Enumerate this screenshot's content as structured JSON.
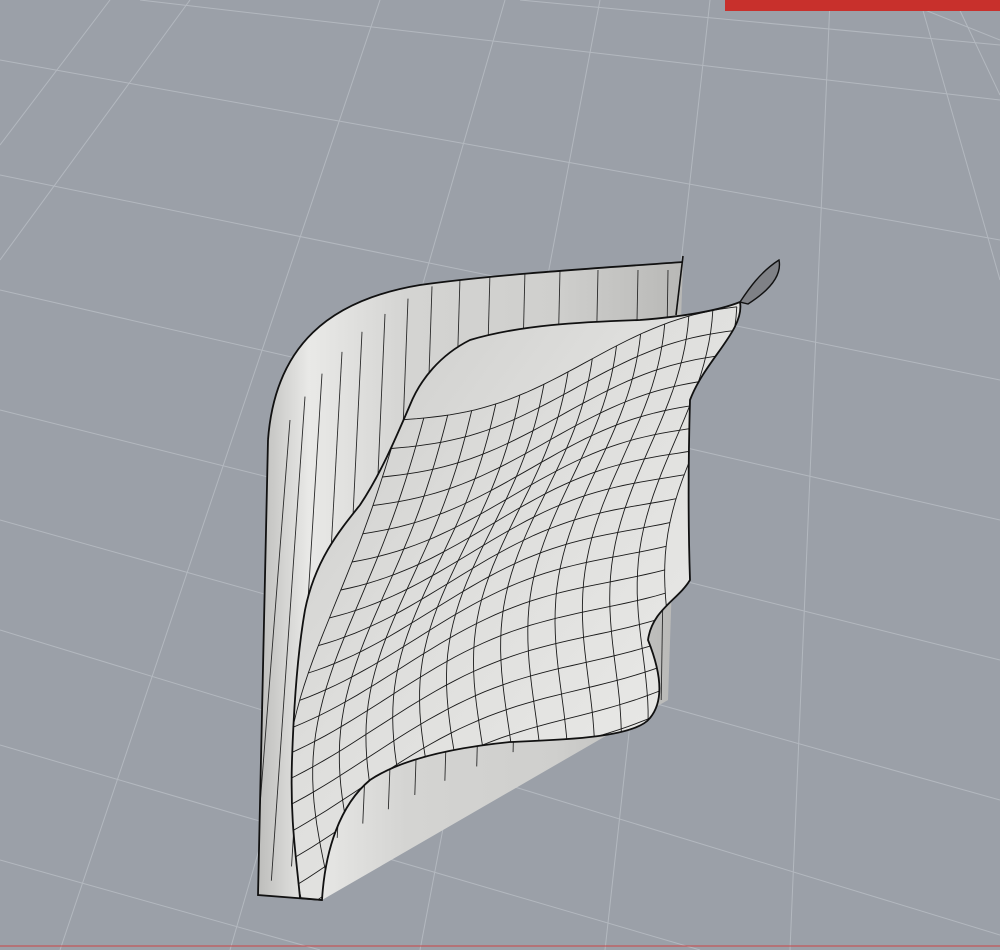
{
  "viewport": {
    "background_color": "#9ba0a8",
    "grid_color": "#b3b8bf",
    "shaded_surface_color": "#d8d8d6",
    "edge_color": "#111111",
    "mesh_color": "#1a1a1a",
    "selection_indicator_color": "#c8302c"
  },
  "scene": {
    "object_count": 2,
    "objects": [
      {
        "id": "back-surface",
        "shape": "curved-sheet",
        "display": "shaded"
      },
      {
        "id": "front-surface",
        "shape": "wavy-freeform-sheet",
        "display": "shaded"
      }
    ]
  }
}
